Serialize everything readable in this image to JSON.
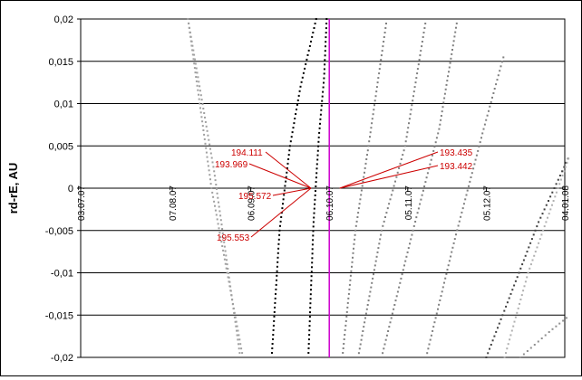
{
  "chart_data": {
    "type": "scatter",
    "title": "",
    "xlabel": "",
    "ylabel": "rd-rE, AU",
    "ylim": [
      -0.02,
      0.02
    ],
    "y_ticks": [
      "0,02",
      "0,015",
      "0,01",
      "0,005",
      "0",
      "-0,005",
      "-0,01",
      "-0,015",
      "-0,02"
    ],
    "y_tick_values": [
      0.02,
      0.015,
      0.01,
      0.005,
      0,
      -0.005,
      -0.01,
      -0.015,
      -0.02
    ],
    "x_axis": {
      "type": "date",
      "crosses_at_y": 0,
      "label_rotation": -90
    },
    "xlim": [
      "2007-07-03",
      "2008-01-04"
    ],
    "x_ticks": [
      "03.07.07",
      "07.08.07",
      "06.09.07",
      "06.10.07",
      "05.11.07",
      "05.12.07",
      "04.01.08"
    ],
    "x_tick_dates": [
      "2007-07-03",
      "2007-08-07",
      "2007-09-06",
      "2007-10-06",
      "2007-11-05",
      "2007-12-05",
      "2008-01-04"
    ],
    "grid": "horizontal",
    "legend": "none",
    "vertical_marker": {
      "x": "2007-10-06",
      "color": "#cc00cc"
    },
    "annotations": [
      {
        "text": "194.111",
        "x": "2007-09-29",
        "y": 0.0
      },
      {
        "text": "193.969",
        "x": "2007-09-29",
        "y": 0.0
      },
      {
        "text": "195.572",
        "x": "2007-09-29",
        "y": 0.0
      },
      {
        "text": "195.553",
        "x": "2007-09-29",
        "y": 0.0
      },
      {
        "text": "193.435",
        "x": "2007-10-10",
        "y": 0.0
      },
      {
        "text": "193.442",
        "x": "2007-10-10",
        "y": 0.0
      }
    ],
    "annotation_color": "#cc0000",
    "series": [
      {
        "color": "#a0a0a0",
        "x": [
          "2007-08-13",
          "2007-08-23",
          "2007-09-02"
        ],
        "y": [
          0.02,
          0.002,
          -0.02
        ]
      },
      {
        "color": "#a0a0a0",
        "x": [
          "2007-08-13",
          "2007-08-22",
          "2007-09-03"
        ],
        "y": [
          0.02,
          0.0,
          -0.02
        ]
      },
      {
        "color": "#000000",
        "x": [
          "2007-10-01",
          "2007-09-25",
          "2007-09-21",
          "2007-09-17",
          "2007-09-14"
        ],
        "y": [
          0.02,
          0.012,
          0.005,
          -0.005,
          -0.02
        ]
      },
      {
        "color": "#000000",
        "x": [
          "2007-10-05",
          "2007-10-04",
          "2007-10-02",
          "2007-09-30",
          "2007-09-28"
        ],
        "y": [
          0.02,
          0.013,
          0.006,
          -0.004,
          -0.02
        ]
      },
      {
        "color": "#808080",
        "x": [
          "2007-10-11",
          "2007-10-16",
          "2007-10-21",
          "2007-10-28"
        ],
        "y": [
          -0.02,
          -0.005,
          0.005,
          0.02
        ]
      },
      {
        "color": "#808080",
        "x": [
          "2007-10-17",
          "2007-10-26",
          "2007-11-04",
          "2007-11-12"
        ],
        "y": [
          -0.02,
          -0.005,
          0.005,
          0.02
        ]
      },
      {
        "color": "#808080",
        "x": [
          "2007-10-26",
          "2007-11-07",
          "2007-11-17",
          "2007-11-24"
        ],
        "y": [
          -0.02,
          -0.005,
          0.007,
          0.02
        ]
      },
      {
        "color": "#808080",
        "x": [
          "2007-11-12",
          "2007-11-23",
          "2007-12-04",
          "2007-12-12"
        ],
        "y": [
          -0.02,
          -0.006,
          0.007,
          0.016
        ]
      },
      {
        "color": "#404040",
        "x": [
          "2007-12-05",
          "2007-12-15",
          "2007-12-25",
          "2008-01-06"
        ],
        "y": [
          -0.02,
          -0.012,
          -0.004,
          0.004
        ]
      },
      {
        "color": "#b0b0b0",
        "x": [
          "2007-12-12",
          "2007-12-21",
          "2008-01-06"
        ],
        "y": [
          -0.02,
          -0.01,
          0.004
        ]
      },
      {
        "color": "#909090",
        "x": [
          "2007-12-18",
          "2007-12-29",
          "2008-01-06"
        ],
        "y": [
          -0.02,
          -0.017,
          -0.015
        ]
      }
    ]
  }
}
